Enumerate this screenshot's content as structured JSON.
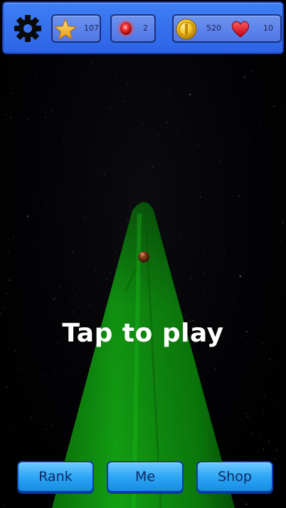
{
  "hud": {
    "stars": "107",
    "gems": "2",
    "coins": "520",
    "lives": "10"
  },
  "center_text": "Tap to play",
  "buttons": {
    "rank": "Rank",
    "me": "Me",
    "shop": "Shop"
  },
  "icons": {
    "settings": "gear-icon",
    "star": "star-icon",
    "gem": "red-gem-icon",
    "coin": "gold-coin-icon",
    "heart": "heart-icon"
  },
  "colors": {
    "hud_blue": "#2c63e6",
    "track_green": "#0f8f10",
    "button_blue": "#2ea6f4"
  }
}
